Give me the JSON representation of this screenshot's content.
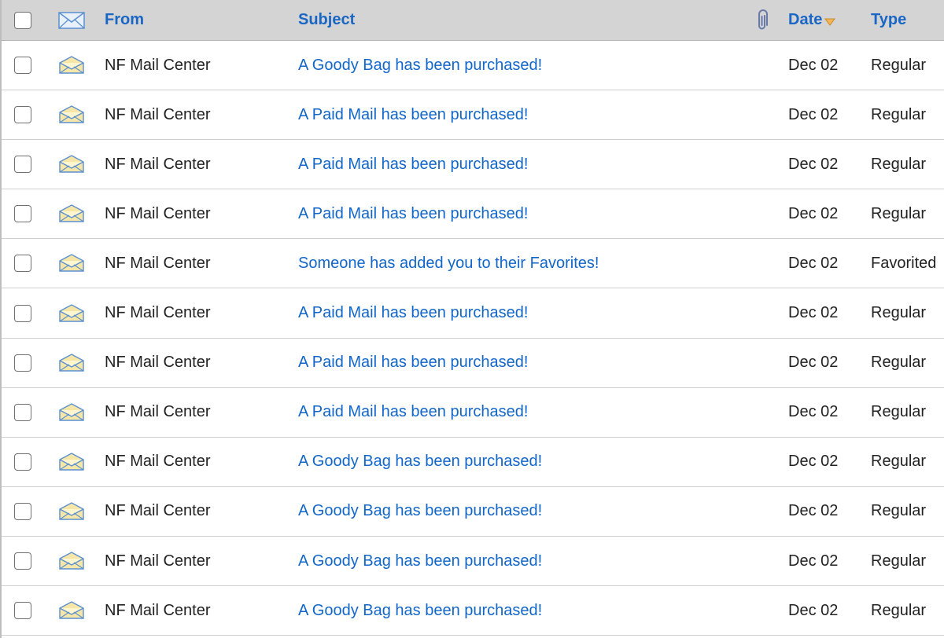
{
  "header": {
    "from_label": "From",
    "subject_label": "Subject",
    "date_label": "Date",
    "type_label": "Type",
    "icons": {
      "envelope": "envelope-icon",
      "attachment": "paperclip-icon",
      "sort": "sort-desc-arrow-icon"
    }
  },
  "colors": {
    "header_bg": "#d4d4d4",
    "link": "#1166c8",
    "header_text": "#1a66c4",
    "sort_arrow": "#e8a33a"
  },
  "messages": [
    {
      "from": "NF Mail Center",
      "subject": "A Goody Bag has been purchased!",
      "date": "Dec 02",
      "type": "Regular"
    },
    {
      "from": "NF Mail Center",
      "subject": "A Paid Mail has been purchased!",
      "date": "Dec 02",
      "type": "Regular"
    },
    {
      "from": "NF Mail Center",
      "subject": "A Paid Mail has been purchased!",
      "date": "Dec 02",
      "type": "Regular"
    },
    {
      "from": "NF Mail Center",
      "subject": "A Paid Mail has been purchased!",
      "date": "Dec 02",
      "type": "Regular"
    },
    {
      "from": "NF Mail Center",
      "subject": "Someone has added you to their Favorites!",
      "date": "Dec 02",
      "type": "Favorited"
    },
    {
      "from": "NF Mail Center",
      "subject": "A Paid Mail has been purchased!",
      "date": "Dec 02",
      "type": "Regular"
    },
    {
      "from": "NF Mail Center",
      "subject": "A Paid Mail has been purchased!",
      "date": "Dec 02",
      "type": "Regular"
    },
    {
      "from": "NF Mail Center",
      "subject": "A Paid Mail has been purchased!",
      "date": "Dec 02",
      "type": "Regular"
    },
    {
      "from": "NF Mail Center",
      "subject": "A Goody Bag has been purchased!",
      "date": "Dec 02",
      "type": "Regular"
    },
    {
      "from": "NF Mail Center",
      "subject": "A Goody Bag has been purchased!",
      "date": "Dec 02",
      "type": "Regular"
    },
    {
      "from": "NF Mail Center",
      "subject": "A Goody Bag has been purchased!",
      "date": "Dec 02",
      "type": "Regular"
    },
    {
      "from": "NF Mail Center",
      "subject": "A Goody Bag has been purchased!",
      "date": "Dec 02",
      "type": "Regular"
    }
  ]
}
